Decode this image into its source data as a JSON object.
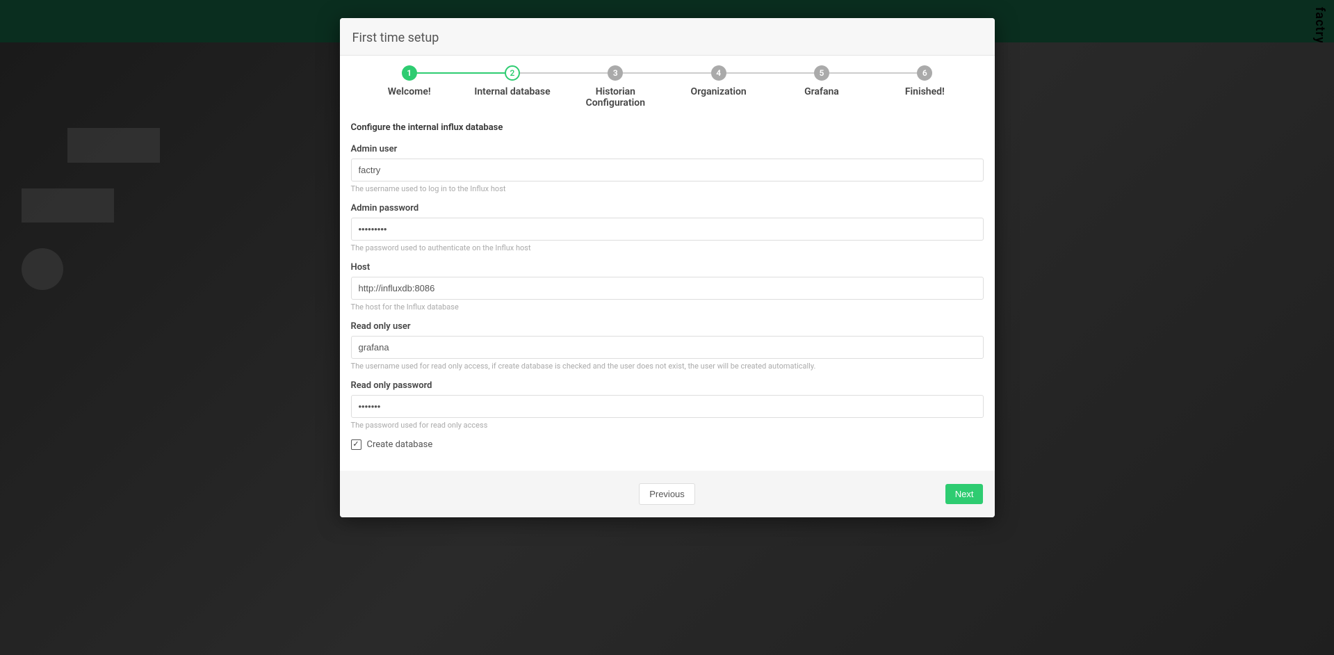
{
  "brand": "factry",
  "modal": {
    "title": "First time setup"
  },
  "stepper": {
    "steps": [
      {
        "num": "1",
        "label": "Welcome!",
        "state": "completed"
      },
      {
        "num": "2",
        "label": "Internal database",
        "state": "current"
      },
      {
        "num": "3",
        "label": "Historian Configuration",
        "state": "pending"
      },
      {
        "num": "4",
        "label": "Organization",
        "state": "pending"
      },
      {
        "num": "5",
        "label": "Grafana",
        "state": "pending"
      },
      {
        "num": "6",
        "label": "Finished!",
        "state": "pending"
      }
    ]
  },
  "form": {
    "section_title": "Configure the internal influx database",
    "admin_user": {
      "label": "Admin user",
      "value": "factry",
      "help": "The username used to log in to the Influx host"
    },
    "admin_password": {
      "label": "Admin password",
      "value": "•••••••••",
      "help": "The password used to authenticate on the Influx host"
    },
    "host": {
      "label": "Host",
      "value": "http://influxdb:8086",
      "help": "The host for the Influx database"
    },
    "readonly_user": {
      "label": "Read only user",
      "value": "grafana",
      "help": "The username used for read only access, if create database is checked and the user does not exist, the user will be created automatically."
    },
    "readonly_password": {
      "label": "Read only password",
      "value": "•••••••",
      "help": "The password used for read only access"
    },
    "create_db": {
      "label": "Create database",
      "checked": true
    }
  },
  "footer": {
    "prev": "Previous",
    "next": "Next"
  }
}
